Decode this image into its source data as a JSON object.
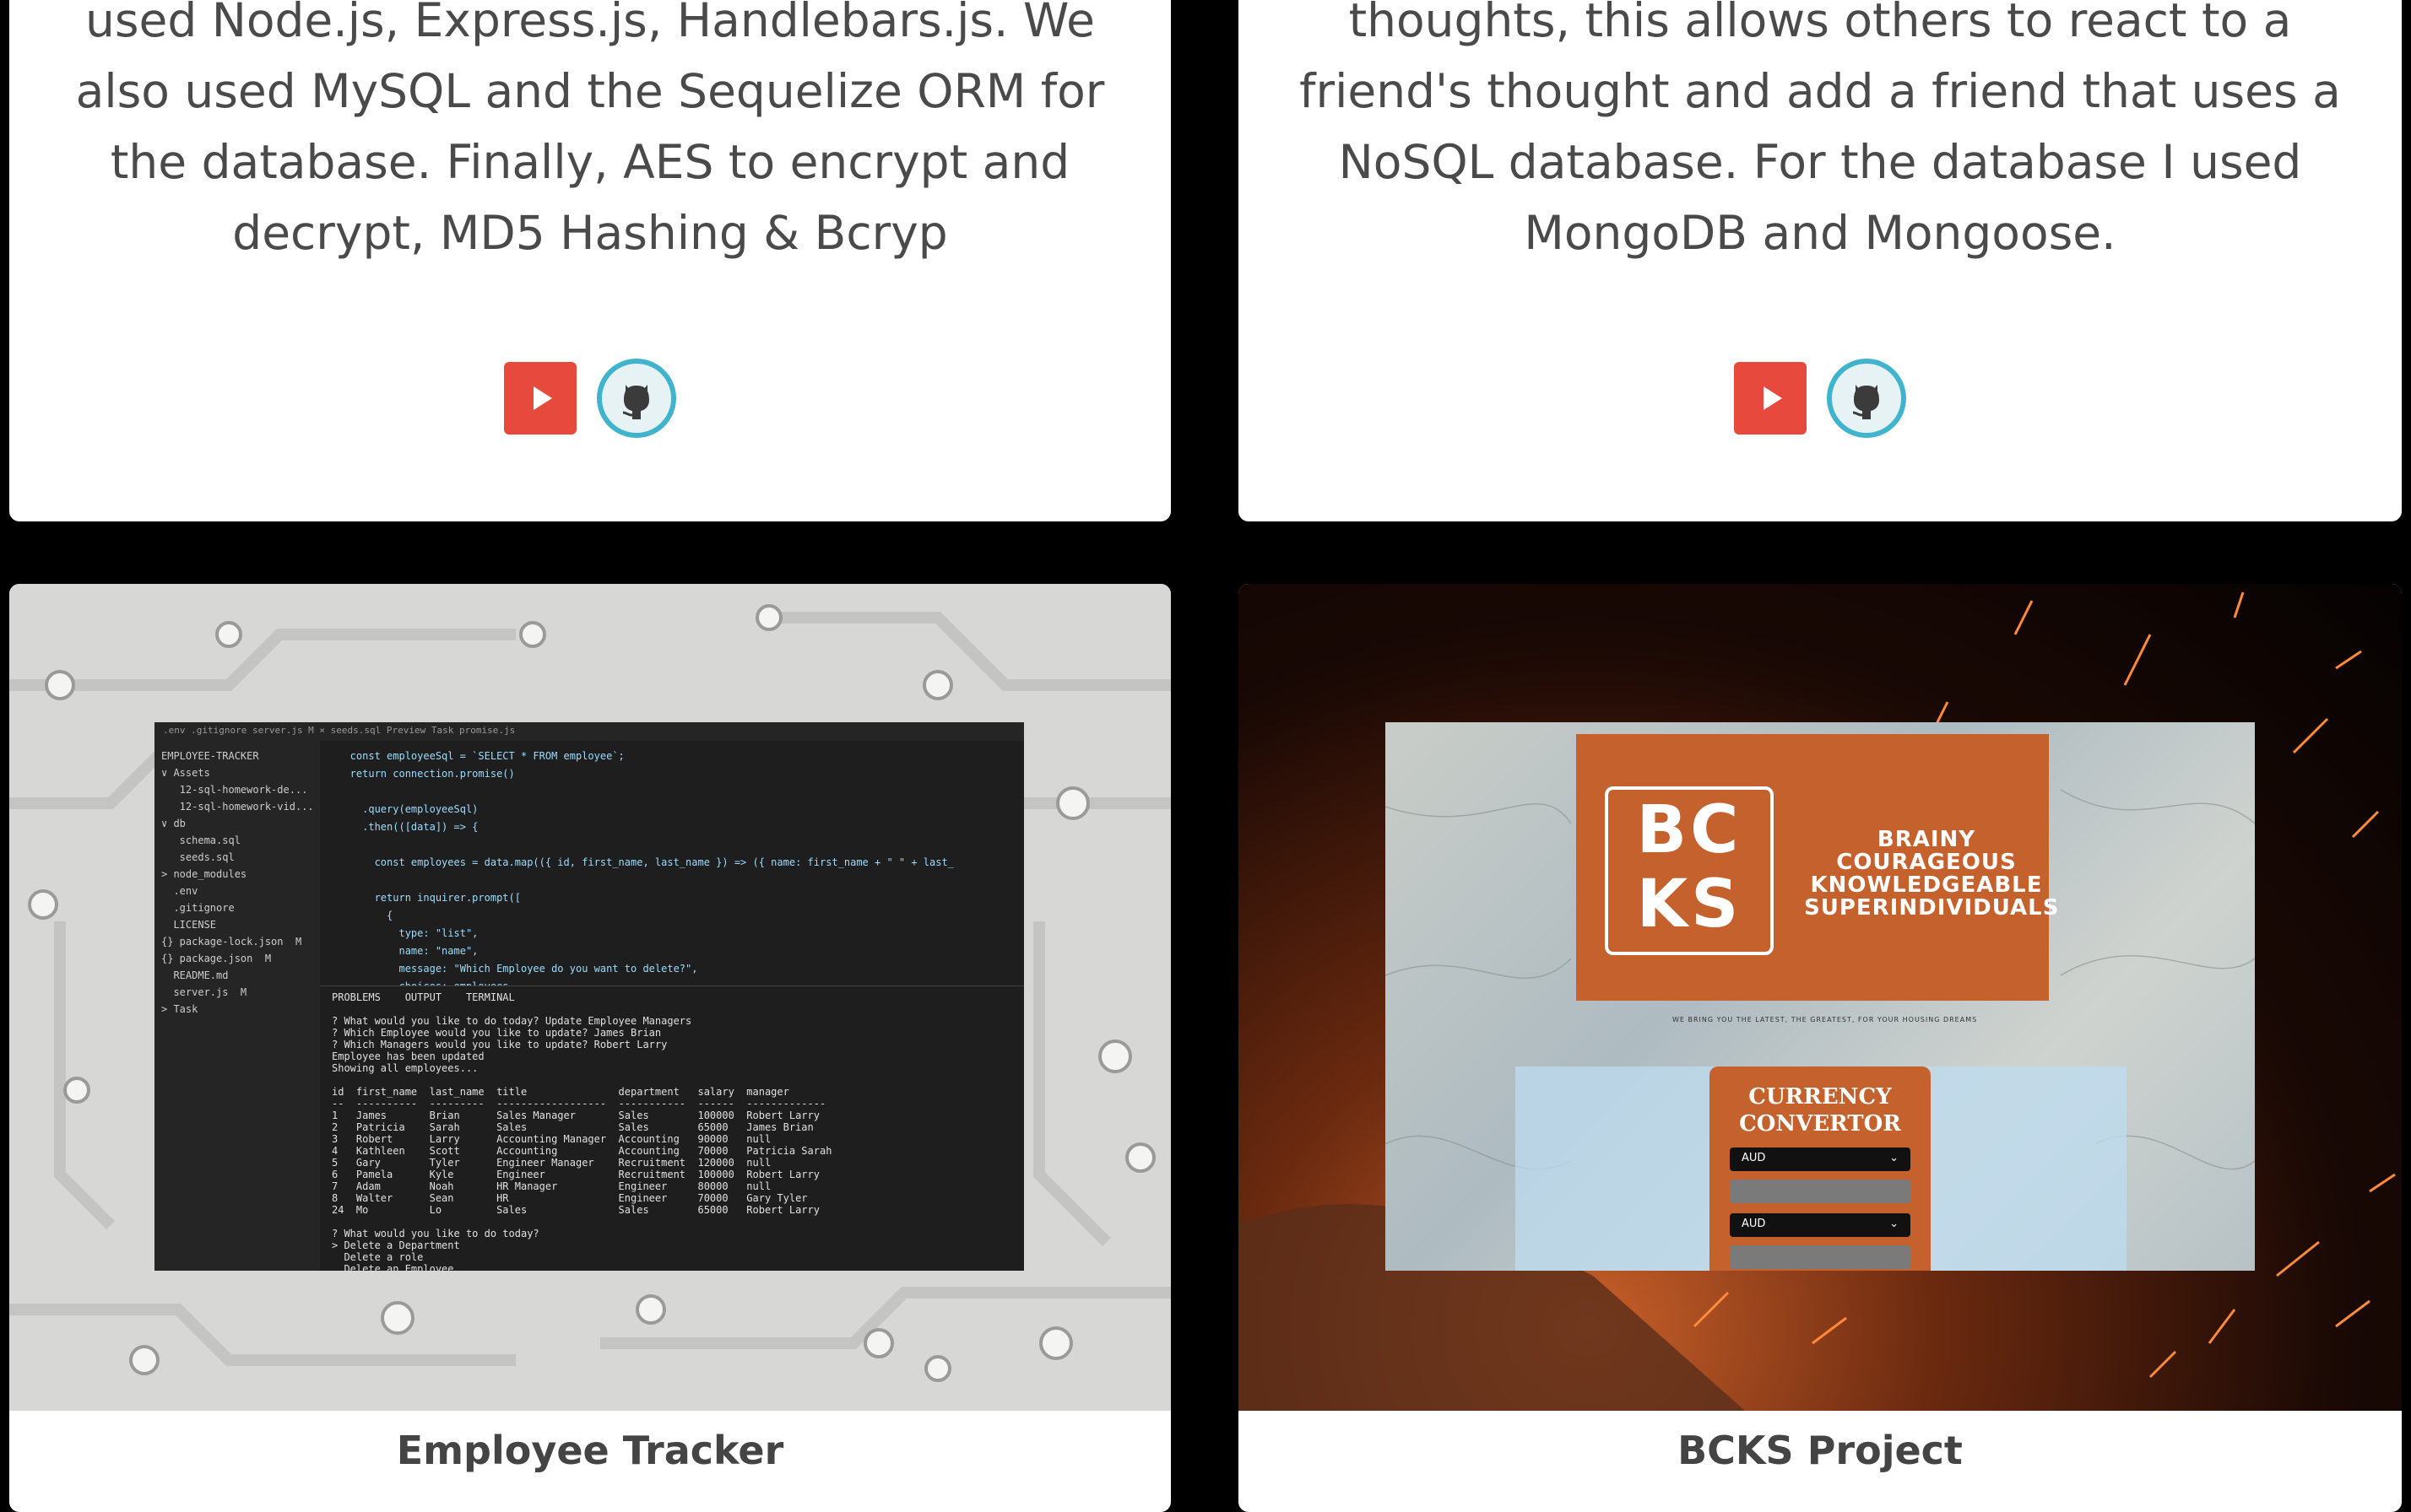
{
  "cards_top": [
    {
      "description": "used Node.js, Express.js, Handlebars.js. We also used MySQL and the Sequelize ORM for the database. Finally, AES to encrypt and decrypt, MD5 Hashing & Bcryp"
    },
    {
      "description": "thoughts, this allows others to react to a friend's thought and add a friend that uses a NoSQL database. For the database I used MongoDB and Mongoose."
    }
  ],
  "cards_bottom": [
    {
      "title": "Employee Tracker",
      "editor": {
        "tabs": ".env    .gitignore    server.js M ×    seeds.sql    Preview Task    promise.js",
        "explorer": "EMPLOYEE-TRACKER\n∨ Assets\n   12-sql-homework-de...\n   12-sql-homework-vid...\n∨ db\n   schema.sql\n   seeds.sql\n> node_modules\n  .env\n  .gitignore\n  LICENSE\n{} package-lock.json  M\n{} package.json  M\n  README.md\n  server.js  M\n> Task",
        "code": "   const employeeSql = `SELECT * FROM employee`;\n   return connection.promise()\n\n     .query(employeeSql)\n     .then(([data]) => {\n\n       const employees = data.map(({ id, first_name, last_name }) => ({ name: first_name + \" \" + last_\n\n       return inquirer.prompt([\n         {\n           type: \"list\",\n           name: \"name\",\n           message: \"Which Employee do you want to delete?\",\n           choices: employees\n         }",
        "terminal": "PROBLEMS    OUTPUT    TERMINAL\n\n? What would you like to do today? Update Employee Managers\n? Which Employee would you like to update? James Brian\n? Which Managers would you like to update? Robert Larry\nEmployee has been updated\nShowing all employees...\n\nid  first_name  last_name  title               department   salary  manager\n--  ----------  ---------  ------------------  -----------  ------  -------------\n1   James       Brian      Sales Manager       Sales        100000  Robert Larry\n2   Patricia    Sarah      Sales               Sales        65000   James Brian\n3   Robert      Larry      Accounting Manager  Accounting   90000   null\n4   Kathleen    Scott      Accounting          Accounting   70000   Patricia Sarah\n5   Gary        Tyler      Engineer Manager    Recruitment  120000  null\n6   Pamela      Kyle       Engineer            Recruitment  100000  Robert Larry\n7   Adam        Noah       HR Manager          Engineer     80000   null\n8   Walter      Sean       HR                  Engineer     70000   Gary Tyler\n24  Mo          Lo         Sales               Sales        65000   Robert Larry\n\n? What would you like to do today?\n> Delete a Department\n  Delete a role\n  Delete an Employee\n  View Department Budgets\n  Exit"
      }
    },
    {
      "title": "BCKS Project",
      "logo": {
        "letters_1": "BC",
        "letters_2": "KS",
        "words": [
          "BRAINY",
          "COURAGEOUS",
          "KNOWLEDGEABLE",
          "SUPERINDIVIDUALS"
        ]
      },
      "tagline": "WE BRING YOU THE LATEST, THE GREATEST, FOR YOUR HOUSING DREAMS",
      "convertor": {
        "title_1": "CURRENCY",
        "title_2": "CONVERTOR",
        "from_currency": "AUD",
        "to_currency": "AUD"
      }
    }
  ],
  "icons": {
    "youtube": "play-icon",
    "github": "github-icon"
  },
  "colors": {
    "background": "#000000",
    "card": "#ffffff",
    "youtube_red": "#e8493d",
    "github_ring": "#3fb4cc",
    "bcks_orange": "#c4612c"
  }
}
